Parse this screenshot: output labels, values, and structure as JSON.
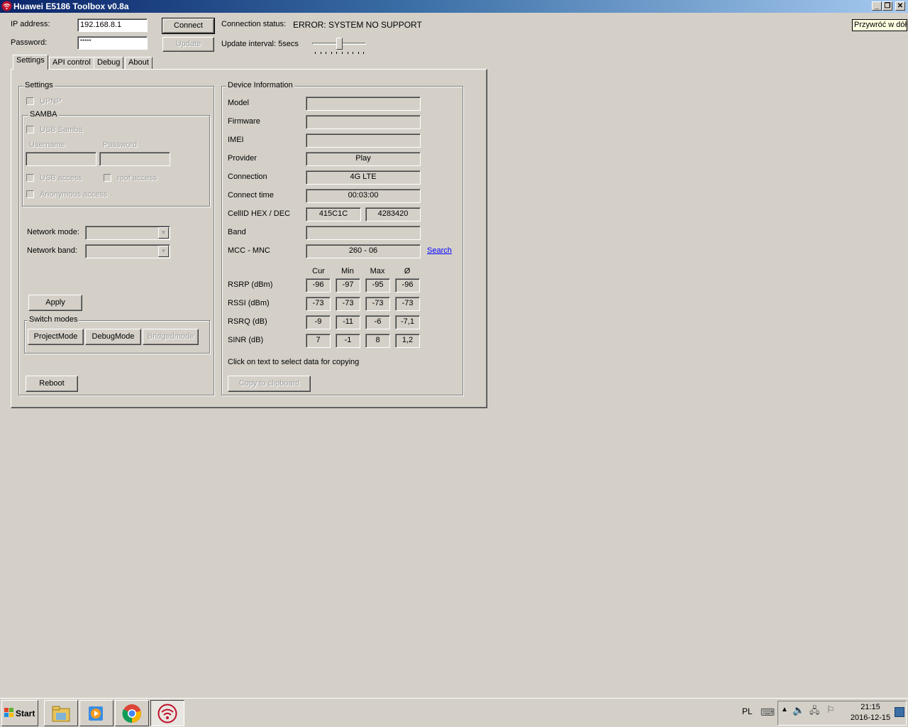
{
  "window": {
    "title": "Huawei E5186 Toolbox v0.8a",
    "tooltip": "Przywróć w dół",
    "caption_minimize": "_",
    "caption_restore": "❐",
    "caption_close": "✕"
  },
  "connection": {
    "ip_label": "IP address:",
    "ip_value": "192.168.8.1",
    "password_label": "Password:",
    "password_value": "*****",
    "connect_label": "Connect",
    "update_label": "Update",
    "status_label": "Connection status:",
    "status_value": "ERROR: SYSTEM NO SUPPORT",
    "interval_label": "Update interval: 5secs",
    "interval_level": 0.5
  },
  "tabs": [
    {
      "label": "Settings",
      "active": true
    },
    {
      "label": "API control",
      "active": false
    },
    {
      "label": "Debug",
      "active": false
    },
    {
      "label": "About",
      "active": false
    }
  ],
  "settings": {
    "group_title": "Settings",
    "upnp": "UPNP",
    "samba_title": "SAMBA",
    "usb_samba": "USB Samba",
    "username_label": "Username",
    "password_label": "Password",
    "usb_access": "USB access",
    "root_access": "root access",
    "anonymous_access": "Anonymous access",
    "network_mode_label": "Network mode:",
    "network_band_label": "Network band:",
    "apply_label": "Apply",
    "switch_title": "Switch modes",
    "project_mode": "ProjectMode",
    "debug_mode": "DebugMode",
    "bridge_mode": "Bridgedmode",
    "reboot_label": "Reboot"
  },
  "device": {
    "group_title": "Device Information",
    "model_label": "Model",
    "model_value": "",
    "firmware_label": "Firmware",
    "firmware_value": "",
    "imei_label": "IMEI",
    "imei_value": "",
    "provider_label": "Provider",
    "provider_value": "Play",
    "connection_label": "Connection",
    "connection_value": "4G LTE",
    "connect_time_label": "Connect time",
    "connect_time_value": "00:03:00",
    "cellid_label": "CellID HEX / DEC",
    "cellid_hex": "415C1C",
    "cellid_dec": "4283420",
    "band_label": "Band",
    "band_value": "",
    "mcc_label": "MCC - MNC",
    "mcc_value": "260 - 06",
    "search_link": "Search",
    "stat_headers": [
      "Cur",
      "Min",
      "Max",
      "Ø"
    ],
    "stats": [
      {
        "label": "RSRP (dBm)",
        "values": [
          "-96",
          "-97",
          "-95",
          "-96"
        ]
      },
      {
        "label": "RSSI (dBm)",
        "values": [
          "-73",
          "-73",
          "-73",
          "-73"
        ]
      },
      {
        "label": "RSRQ (dB)",
        "values": [
          "-9",
          "-11",
          "-6",
          "-7,1"
        ]
      },
      {
        "label": "SINR (dB)",
        "values": [
          "7",
          "-1",
          "8",
          "1,2"
        ]
      }
    ],
    "copy_hint": "Click on text to select data for copying",
    "copy_button": "Copy to clipboard"
  },
  "taskbar": {
    "start_label": "Start",
    "language": "PL",
    "time": "21:15",
    "date": "2016-12-15",
    "apps": [
      "file-explorer-icon",
      "media-player-icon",
      "chrome-icon",
      "wifi-toolbox-icon"
    ]
  }
}
